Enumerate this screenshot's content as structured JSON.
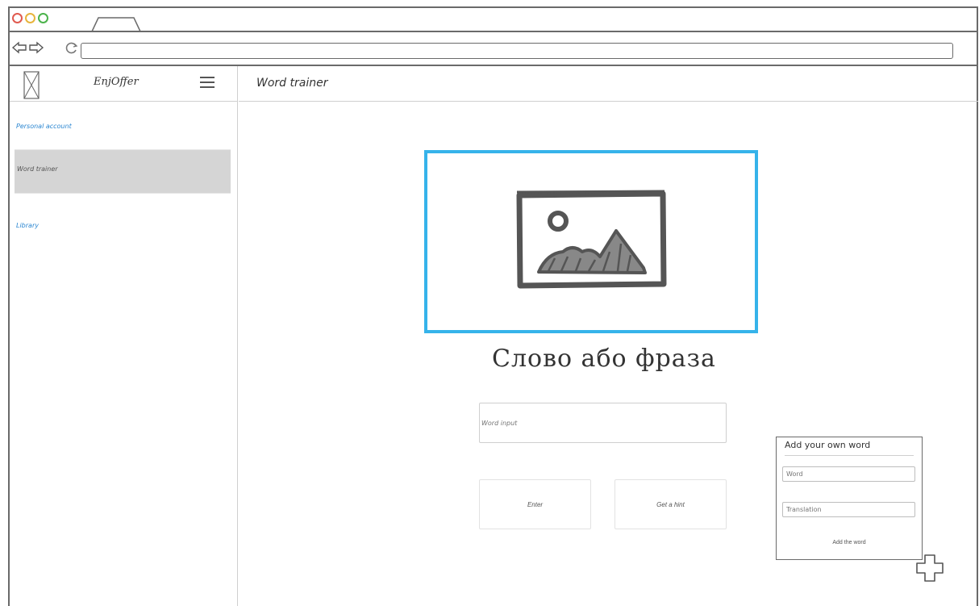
{
  "app": {
    "name": "EnjOffer"
  },
  "sidebar": {
    "items": [
      {
        "label": "Personal account"
      },
      {
        "label": "Word trainer"
      },
      {
        "label": "Library"
      }
    ]
  },
  "header": {
    "title": "Word trainer"
  },
  "trainer": {
    "word_phrase": "Слово або фраза",
    "input_placeholder": "Word input",
    "enter_label": "Enter",
    "hint_label": "Get a hint"
  },
  "add_word": {
    "title": "Add your own word",
    "word_placeholder": "Word",
    "translation_placeholder": "Translation",
    "submit_label": "Add the word"
  },
  "icons": {
    "logo": "image-placeholder-icon",
    "menu": "hamburger-icon",
    "picture": "picture-icon",
    "add": "plus-icon"
  },
  "colors": {
    "accent": "#36b3ea",
    "link": "#2a86d1",
    "active_item_bg": "#d5d5d5"
  }
}
